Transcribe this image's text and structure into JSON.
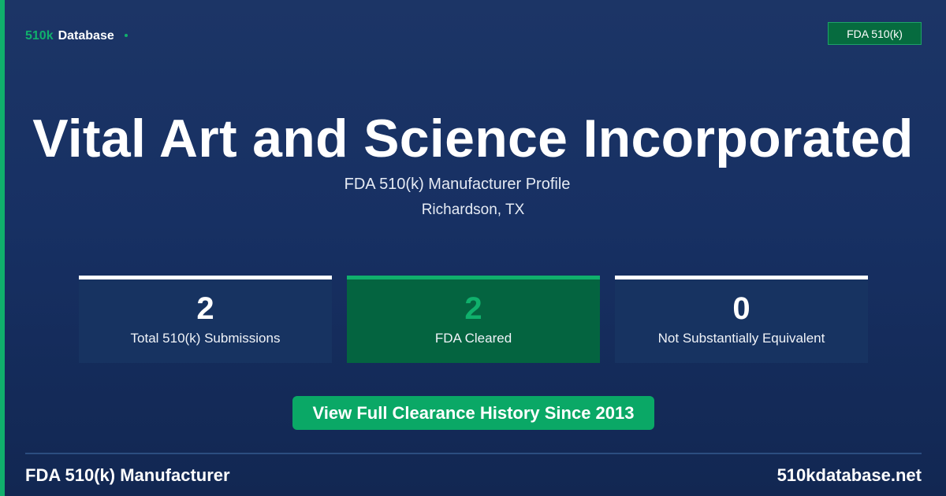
{
  "brand": {
    "part1": "510k",
    "part2": "Database"
  },
  "badge": {
    "label": "FDA 510(k)"
  },
  "header": {
    "title": "Vital Art and Science Incorporated",
    "subtitle": "FDA 510(k) Manufacturer Profile",
    "location": "Richardson, TX"
  },
  "stats": [
    {
      "value": "2",
      "label": "Total 510(k) Submissions"
    },
    {
      "value": "2",
      "label": "FDA Cleared"
    },
    {
      "value": "0",
      "label": "Not Substantially Equivalent"
    }
  ],
  "cta": {
    "label": "View Full Clearance History Since 2013"
  },
  "footer": {
    "left": "FDA 510(k) Manufacturer",
    "right": "510kdatabase.net"
  },
  "colors": {
    "accent": "#10b06c",
    "background": "#1c3566",
    "cleared_card": "#046440"
  }
}
